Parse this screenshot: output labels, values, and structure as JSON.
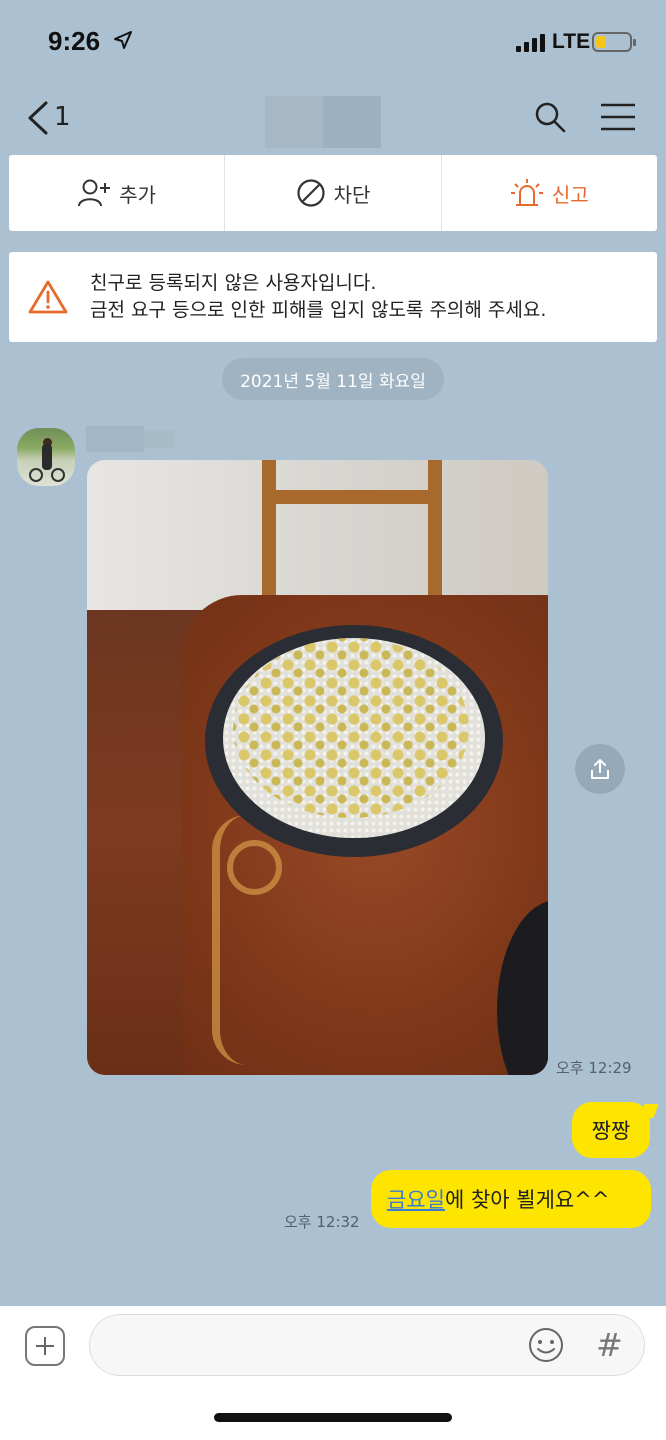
{
  "status_bar": {
    "time": "9:26",
    "network": "LTE",
    "battery_level": 0.3,
    "battery_color": "#f5c518"
  },
  "nav": {
    "back_count": "1",
    "icons": [
      "back-icon",
      "search-icon",
      "menu-icon"
    ]
  },
  "actions": [
    {
      "label": "추가",
      "icon": "add-friend-icon"
    },
    {
      "label": "차단",
      "icon": "block-icon"
    },
    {
      "label": "신고",
      "icon": "report-siren-icon",
      "color": "#e66a2c"
    }
  ],
  "warning": {
    "line1": "친구로 등록되지 않은 사용자입니다.",
    "line2": "금전 요구 등으로 인한 피해를 입지 않도록 주의해 주세요.",
    "icon": "warning-icon",
    "icon_color": "#e66a2c"
  },
  "chat": {
    "date": "2021년 5월 11일 화요일",
    "incoming": {
      "time": "오후 12:29"
    },
    "outgoing": [
      {
        "text": "짱짱"
      },
      {
        "link_text": "금요일",
        "rest_text": "에 찾아 뵐게요^^",
        "time": "오후 12:32"
      }
    ]
  },
  "colors": {
    "background": "#abc1d1",
    "bubble_out": "#fee500",
    "link": "#3a7bd5"
  }
}
